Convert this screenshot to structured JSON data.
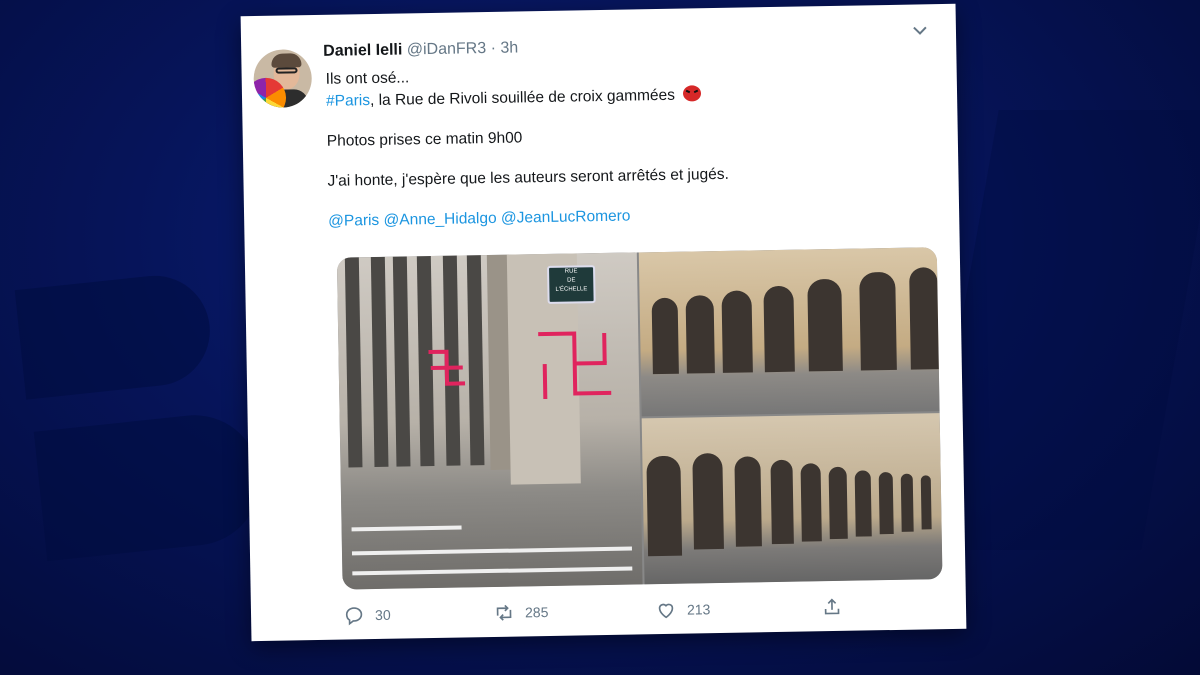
{
  "tweet": {
    "author_name": "Daniel Ielli",
    "handle": "@iDanFR3",
    "separator": "·",
    "time": "3h",
    "lines": [
      "Ils ont osé...",
      "la Rue de Rivoli souillée de croix gammées",
      "Photos prises ce matin 9h00",
      "J'ai honte, j'espère que les auteurs seront arrêtés et jugés."
    ],
    "hashtag": "#Paris",
    "hashtag_suffix": ",",
    "mentions": [
      "@Paris",
      "@Anne_Hidalgo",
      "@JeanLucRomero"
    ],
    "emoji": "angry-face-symbols-emoji",
    "photo_sign": [
      "RUE",
      "DE",
      "L'ÉCHELLE"
    ]
  },
  "actions": {
    "replies": "30",
    "retweets": "285",
    "likes": "213"
  },
  "icons": {
    "menu": "chevron-down-icon",
    "reply": "reply-icon",
    "retweet": "retweet-icon",
    "like": "heart-icon",
    "share": "share-icon"
  },
  "colors": {
    "background": "#061459",
    "link": "#1b95e0",
    "muted": "#657786",
    "graffiti": "#e0245e"
  }
}
